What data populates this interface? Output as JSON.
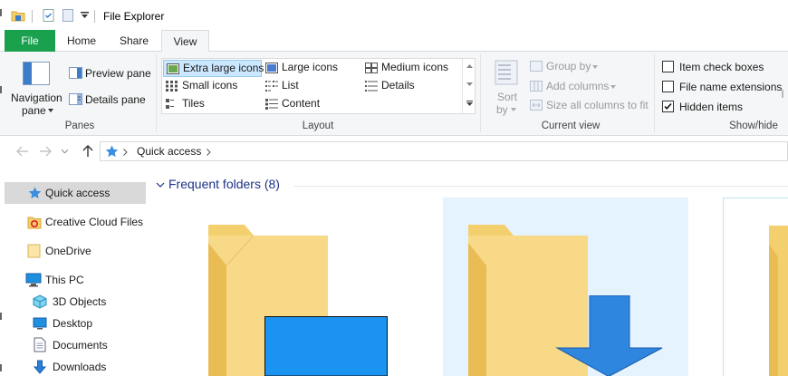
{
  "window": {
    "title": "File Explorer"
  },
  "ribbon_tabs": {
    "file": "File",
    "home": "Home",
    "share": "Share",
    "view": "View"
  },
  "panes": {
    "navigation_pane": "Navigation",
    "navigation_pane_2": "pane",
    "preview_pane": "Preview pane",
    "details_pane": "Details pane",
    "group_label": "Panes"
  },
  "layout": {
    "extra_large": "Extra large icons",
    "large": "Large icons",
    "medium": "Medium icons",
    "small": "Small icons",
    "list": "List",
    "details": "Details",
    "tiles": "Tiles",
    "content": "Content",
    "group_label": "Layout",
    "selected": "Extra large icons"
  },
  "current_view": {
    "sort_by_1": "Sort",
    "sort_by_2": "by",
    "group_by": "Group by",
    "add_columns": "Add columns",
    "size_all_columns": "Size all columns to fit",
    "group_label": "Current view"
  },
  "show_hide": {
    "item_check_boxes": "Item check boxes",
    "file_name_extensions": "File name extensions",
    "hidden_items": "Hidden items",
    "group_label": "Show/hide",
    "item_check_boxes_checked": false,
    "file_name_extensions_checked": false,
    "hidden_items_checked": true
  },
  "address": {
    "crumb": "Quick access"
  },
  "nav": {
    "quick_access": "Quick access",
    "creative_cloud": "Creative Cloud Files",
    "onedrive": "OneDrive",
    "this_pc": "This PC",
    "objects_3d": "3D Objects",
    "desktop": "Desktop",
    "documents": "Documents",
    "downloads": "Downloads"
  },
  "content": {
    "frequent_folders": "Frequent folders (8)"
  },
  "colors": {
    "file_tab": "#19a14e",
    "selection": "#cce8ff",
    "selection_border": "#99c9ef",
    "header_text": "#1e3287",
    "folder": "#f5cf6b",
    "folder_dark": "#e2b14a",
    "accent_blue": "#1e90e8"
  },
  "icons": [
    "home-folder-icon",
    "properties-icon",
    "new-folder-icon",
    "dropdown-icon",
    "back-icon",
    "forward-icon",
    "up-icon",
    "star-icon",
    "cloud-icon",
    "pc-icon",
    "cube-icon",
    "desktop-icon",
    "documents-icon",
    "downloads-icon"
  ]
}
